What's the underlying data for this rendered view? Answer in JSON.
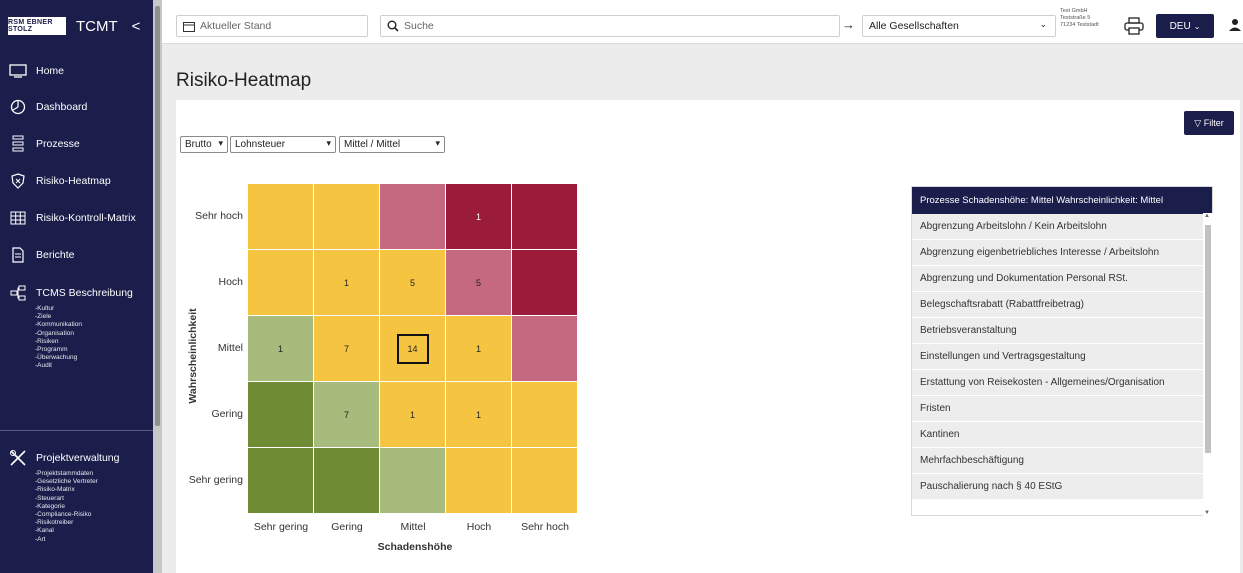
{
  "sidebar": {
    "logo_text": "RSM EBNER STOLZ",
    "title": "TCMT",
    "collapse_glyph": "<",
    "items": [
      {
        "label": "Home",
        "icon": "monitor-icon"
      },
      {
        "label": "Dashboard",
        "icon": "dashboard-icon"
      },
      {
        "label": "Prozesse",
        "icon": "process-icon"
      },
      {
        "label": "Risiko-Heatmap",
        "icon": "shield-icon"
      },
      {
        "label": "Risiko-Kontroll-Matrix",
        "icon": "grid-icon"
      },
      {
        "label": "Berichte",
        "icon": "document-icon"
      },
      {
        "label": "TCMS Beschreibung",
        "icon": "hierarchy-icon"
      }
    ],
    "tcms_sub": [
      "-Kultur",
      "-Ziele",
      "-Kommunikation",
      "-Organisation",
      "-Risiken",
      "-Programm",
      "-Überwachung",
      "-Audit"
    ],
    "project": {
      "label": "Projektverwaltung",
      "icon": "tools-icon"
    },
    "project_sub": [
      "-Projektstammdaten",
      "-Gesetzliche Vertreter",
      "-Risiko-Matrix",
      "-Steuerart",
      "-Kategorie",
      "-Compliance-Risiko",
      "-Risikotreiber",
      "-Kanal",
      "-Art"
    ]
  },
  "topbar": {
    "status_field": "Aktueller Stand",
    "search_placeholder": "Suche",
    "arrow": "→",
    "company_select": "Alle Gesellschaften",
    "company_info": [
      "Test GmbH",
      "Teststraße 5",
      "71234 Teststadt"
    ],
    "language": "DEU"
  },
  "page": {
    "title": "Risiko-Heatmap",
    "filter_label": "▽ Filter",
    "selects": [
      "Brutto",
      "Lohnsteuer",
      "Mittel / Mittel"
    ]
  },
  "heatmap": {
    "rows": [
      "Sehr hoch",
      "Hoch",
      "Mittel",
      "Gering",
      "Sehr gering"
    ],
    "cols": [
      "Sehr gering",
      "Gering",
      "Mittel",
      "Hoch",
      "Sehr hoch"
    ],
    "x_title": "Schadenshöhe",
    "y_title": "Wahrscheinlichkeit",
    "colors": {
      "yellow": "#f5c542",
      "pink": "#c4697f",
      "red": "#9b1b3a",
      "lightgreen": "#a6bb7c",
      "darkgreen": "#6f8c35"
    },
    "cells": [
      [
        {
          "c": "yellow",
          "v": ""
        },
        {
          "c": "yellow",
          "v": ""
        },
        {
          "c": "pink",
          "v": ""
        },
        {
          "c": "red",
          "v": "1"
        },
        {
          "c": "red",
          "v": ""
        }
      ],
      [
        {
          "c": "yellow",
          "v": ""
        },
        {
          "c": "yellow",
          "v": "1"
        },
        {
          "c": "yellow",
          "v": "5"
        },
        {
          "c": "pink",
          "v": "5"
        },
        {
          "c": "red",
          "v": ""
        }
      ],
      [
        {
          "c": "lightgreen",
          "v": "1"
        },
        {
          "c": "yellow",
          "v": "7"
        },
        {
          "c": "yellow",
          "v": "14",
          "selected": true
        },
        {
          "c": "yellow",
          "v": "1"
        },
        {
          "c": "pink",
          "v": ""
        }
      ],
      [
        {
          "c": "darkgreen",
          "v": ""
        },
        {
          "c": "lightgreen",
          "v": "7"
        },
        {
          "c": "yellow",
          "v": "1"
        },
        {
          "c": "yellow",
          "v": "1"
        },
        {
          "c": "yellow",
          "v": ""
        }
      ],
      [
        {
          "c": "darkgreen",
          "v": ""
        },
        {
          "c": "darkgreen",
          "v": ""
        },
        {
          "c": "lightgreen",
          "v": ""
        },
        {
          "c": "yellow",
          "v": ""
        },
        {
          "c": "yellow",
          "v": ""
        }
      ]
    ]
  },
  "panel": {
    "header": "Prozesse   Schadenshöhe: Mittel   Wahrscheinlichkeit: Mittel",
    "items": [
      "Abgrenzung Arbeitslohn / Kein Arbeitslohn",
      "Abgrenzung eigenbetriebliches Interesse / Arbeitslohn",
      "Abgrenzung und Dokumentation Personal RSt.",
      "Belegschaftsrabatt (Rabattfreibetrag)",
      "Betriebsveranstaltung",
      "Einstellungen und Vertragsgestaltung",
      "Erstattung von Reisekosten - Allgemeines/Organisation",
      "Fristen",
      "Kantinen",
      "Mehrfachbeschäftigung",
      "Pauschalierung nach § 40 EStG"
    ]
  }
}
